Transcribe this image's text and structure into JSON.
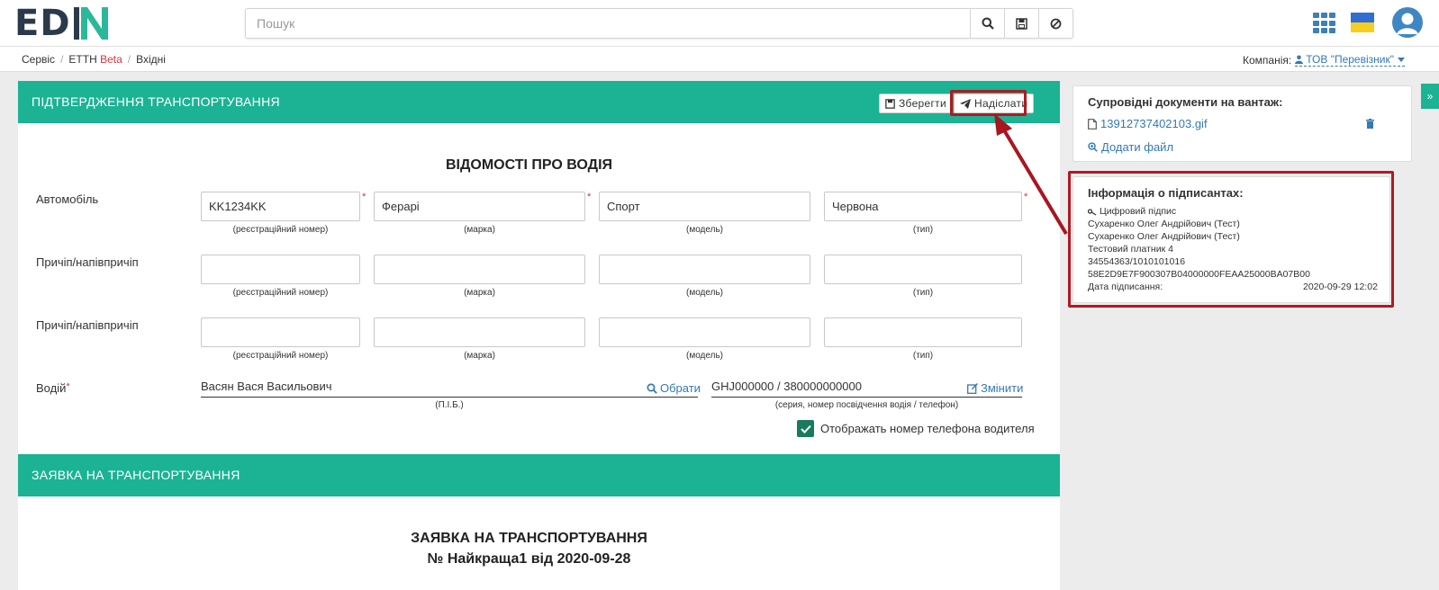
{
  "header": {
    "logo_text_a": "ED",
    "logo_text_b": "N",
    "search_placeholder": "Пошук",
    "icons": [
      "search-icon",
      "save-icon",
      "cancel-icon",
      "apps-grid-icon",
      "ukraine-flag-icon",
      "user-avatar-icon"
    ]
  },
  "breadcrumb": {
    "items": [
      "Сервіс",
      "ЕТТН",
      "Вхідні"
    ],
    "beta": "Beta"
  },
  "company": {
    "label": "Компанія:",
    "value": "ТОВ \"Перевізник\""
  },
  "section1": {
    "title": "ПІДТВЕРДЖЕННЯ ТРАНСПОРТУВАННЯ",
    "save_label": "Зберегти",
    "send_label": "Надіслати"
  },
  "driver_info": {
    "title": "ВІДОМОСТІ ПРО ВОДІЯ",
    "rows": [
      {
        "label": "Автомобіль",
        "values": [
          "KK1234KK",
          "Ферарі",
          "Спорт",
          "Червона"
        ]
      },
      {
        "label": "Причіп/напівпричіп",
        "values": [
          "",
          "",
          "",
          ""
        ]
      },
      {
        "label": "Причіп/напівпричіп",
        "values": [
          "",
          "",
          "",
          ""
        ]
      }
    ],
    "hints": [
      "(реєстраційний номер)",
      "(марка)",
      "(модель)",
      "(тип)"
    ],
    "driver_label": "Водій",
    "driver_name": "Васян Вася Васильович",
    "driver_name_hint": "(П.І.Б.)",
    "choose_label": "Обрати",
    "driver_doc": "GHJ000000 / 380000000000",
    "driver_doc_hint": "(серия, номер посвідчення водія / телефон)",
    "change_label": "Змінити",
    "show_phone_label": "Отображать номер телефона водителя",
    "show_phone_checked": true
  },
  "section2": {
    "title": "ЗАЯВКА НА ТРАНСПОРТУВАННЯ",
    "doc_title": "ЗАЯВКА НА ТРАНСПОРТУВАННЯ",
    "doc_number": "№ Найкраща1 від 2020-09-28"
  },
  "attachments": {
    "title": "Супровідні документи на вантаж:",
    "file": "13912737402103.gif",
    "add_label": "Додати файл"
  },
  "signers": {
    "title": "Інформація о підписантах:",
    "sig_type": "Цифровий підпис",
    "lines": [
      "Сухаренко Олег Андрійович (Тест)",
      "Сухаренко Олег Андрійович (Тест)",
      "Тестовий платник 4",
      "34554363/1010101016",
      "58E2D9E7F900307B04000000FEAA25000BA07B00"
    ],
    "date_label": "Дата підписання:",
    "date_value": "2020-09-29 12:02"
  },
  "colors": {
    "accent": "#1bb394",
    "link": "#3479b8",
    "highlight": "#b01923"
  }
}
